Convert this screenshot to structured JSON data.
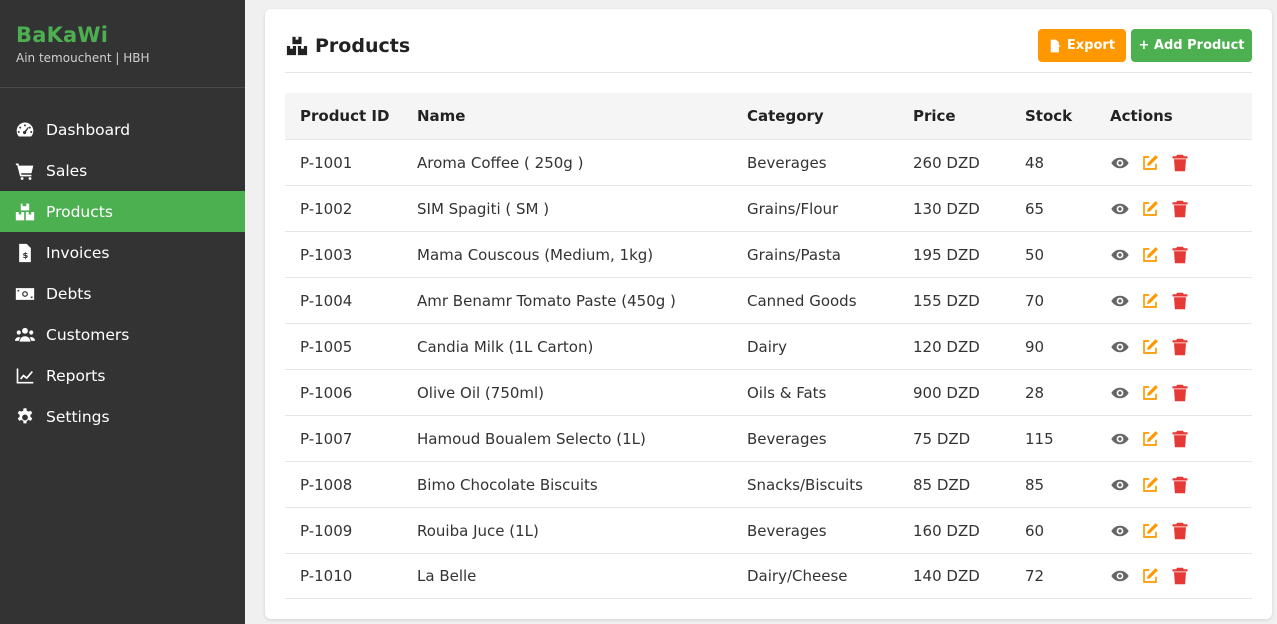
{
  "brand": {
    "title": "BaKaWi",
    "subtitle": "Ain temouchent | HBH"
  },
  "nav": [
    {
      "label": "Dashboard",
      "icon": "dashboard-gauge-icon",
      "active": false
    },
    {
      "label": "Sales",
      "icon": "cart-icon",
      "active": false
    },
    {
      "label": "Products",
      "icon": "boxes-icon",
      "active": true
    },
    {
      "label": "Invoices",
      "icon": "invoice-icon",
      "active": false
    },
    {
      "label": "Debts",
      "icon": "money-bill-icon",
      "active": false
    },
    {
      "label": "Customers",
      "icon": "users-icon",
      "active": false
    },
    {
      "label": "Reports",
      "icon": "chart-line-icon",
      "active": false
    },
    {
      "label": "Settings",
      "icon": "gear-icon",
      "active": false
    }
  ],
  "page": {
    "title": "Products",
    "export_label": "Export",
    "add_label": "+ Add Product"
  },
  "table": {
    "headers": [
      "Product ID",
      "Name",
      "Category",
      "Price",
      "Stock",
      "Actions"
    ],
    "rows": [
      {
        "id": "P-1001",
        "name": "Aroma Coffee ( 250g )",
        "category": "Beverages",
        "price": "260 DZD",
        "stock": "48"
      },
      {
        "id": "P-1002",
        "name": "SIM Spagiti ( SM )",
        "category": "Grains/Flour",
        "price": "130 DZD",
        "stock": "65"
      },
      {
        "id": "P-1003",
        "name": "Mama Couscous (Medium, 1kg)",
        "category": "Grains/Pasta",
        "price": "195 DZD",
        "stock": "50"
      },
      {
        "id": "P-1004",
        "name": "Amr Benamr Tomato Paste (450g )",
        "category": "Canned Goods",
        "price": "155 DZD",
        "stock": "70"
      },
      {
        "id": "P-1005",
        "name": "Candia Milk (1L Carton)",
        "category": "Dairy",
        "price": "120 DZD",
        "stock": "90"
      },
      {
        "id": "P-1006",
        "name": "Olive Oil (750ml)",
        "category": "Oils & Fats",
        "price": "900 DZD",
        "stock": "28"
      },
      {
        "id": "P-1007",
        "name": "Hamoud Boualem Selecto (1L)",
        "category": "Beverages",
        "price": "75 DZD",
        "stock": "115"
      },
      {
        "id": "P-1008",
        "name": "Bimo Chocolate Biscuits",
        "category": "Snacks/Biscuits",
        "price": "85 DZD",
        "stock": "85"
      },
      {
        "id": "P-1009",
        "name": "Rouiba Juce (1L)",
        "category": "Beverages",
        "price": "160 DZD",
        "stock": "60"
      },
      {
        "id": "P-1010",
        "name": "La Belle",
        "category": "Dairy/Cheese",
        "price": "140 DZD",
        "stock": "72"
      }
    ]
  },
  "colors": {
    "accent": "#4caf50",
    "sidebar": "#333333",
    "export": "#ff9800",
    "view": "#666666",
    "edit": "#ff9800",
    "delete": "#e53935"
  }
}
